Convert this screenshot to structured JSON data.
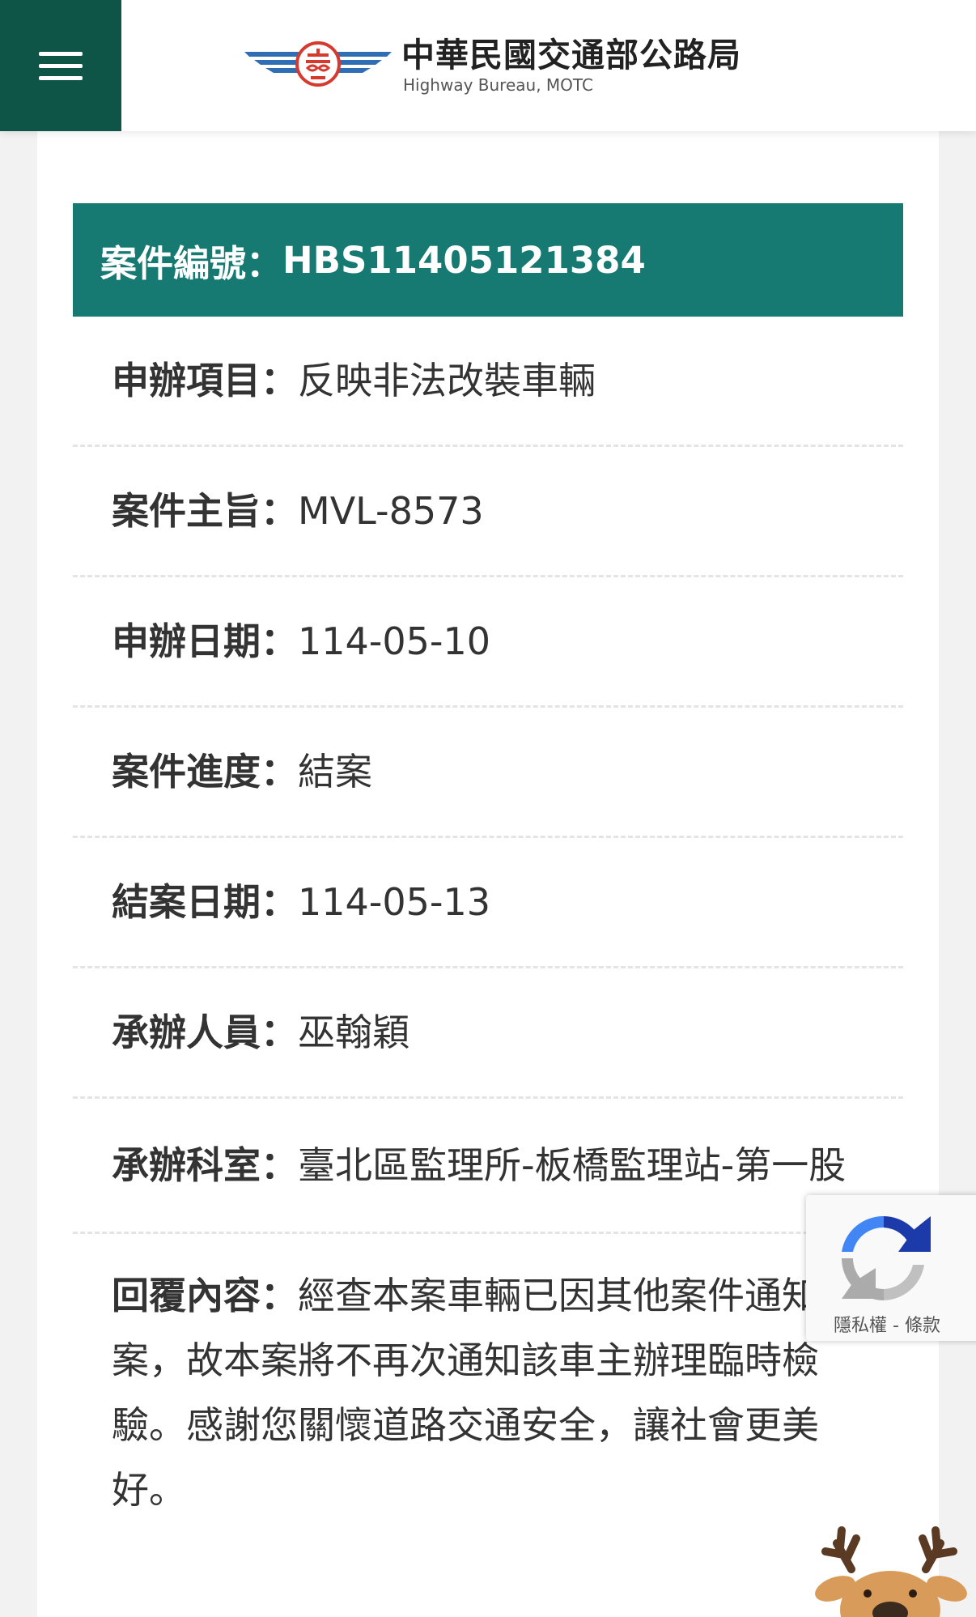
{
  "header": {
    "logo_zh": "中華民國交通部公路局",
    "logo_en": "Highway Bureau, MOTC",
    "menu_icon": "hamburger-menu-icon",
    "brand_colors": {
      "menu_bg": "#0e5548",
      "wing_blue": "#2f6db5",
      "emblem_red": "#d63a2f"
    }
  },
  "case": {
    "title_label": "案件編號：",
    "number": "HBS11405121384",
    "title_bg": "#167a72"
  },
  "rows": [
    {
      "label": "申辦項目：",
      "value": "反映非法改裝車輛"
    },
    {
      "label": "案件主旨：",
      "value": "MVL-8573"
    },
    {
      "label": "申辦日期：",
      "value": "114-05-10"
    },
    {
      "label": "案件進度：",
      "value": "結案"
    },
    {
      "label": "結案日期：",
      "value": "114-05-13"
    },
    {
      "label": "承辦人員：",
      "value": "巫翰穎"
    },
    {
      "label": "承辦科室：",
      "value": "臺北區監理所-板橋監理站-第一股"
    },
    {
      "label": "回覆內容：",
      "value": "經查本案車輛已因其他案件通知在案，故本案將不再次通知該車主辦理臨時檢驗。感謝您關懷道路交通安全，讓社會更美好。"
    }
  ],
  "recaptcha": {
    "privacy": "隱私權",
    "separator": " - ",
    "terms": "條款",
    "icon": "recaptcha-icon"
  },
  "mascot": {
    "icon": "reindeer-mascot-icon"
  }
}
